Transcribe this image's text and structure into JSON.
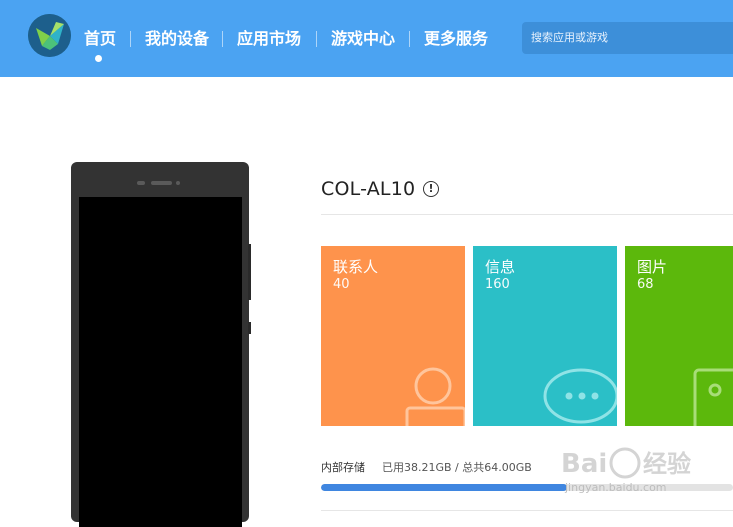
{
  "nav": {
    "items": [
      {
        "label": "首页",
        "active": true
      },
      {
        "label": "我的设备"
      },
      {
        "label": "应用市场"
      },
      {
        "label": "游戏中心"
      },
      {
        "label": "更多服务"
      }
    ],
    "search_placeholder": "搜索应用或游戏"
  },
  "device": {
    "name": "COL-AL10",
    "info_icon": "info-circle-icon"
  },
  "tiles": [
    {
      "label": "联系人",
      "count": "40",
      "color": "#fe934c",
      "icon": "contact-person-icon"
    },
    {
      "label": "信息",
      "count": "160",
      "color": "#2bbfc7",
      "icon": "chat-bubble-icon"
    },
    {
      "label": "图片",
      "count": "68",
      "color": "#5cb80c",
      "icon": "picture-icon"
    }
  ],
  "storage": {
    "label": "内部存储",
    "used_text": "已用38.21GB / 总共64.00GB",
    "used_fraction": 0.597
  },
  "watermark": {
    "brand": "Baidu经验",
    "url": "jingyan.baidu.com"
  },
  "colors": {
    "topbar": "#4ba3f2",
    "accent_bar": "#3f86e0"
  }
}
